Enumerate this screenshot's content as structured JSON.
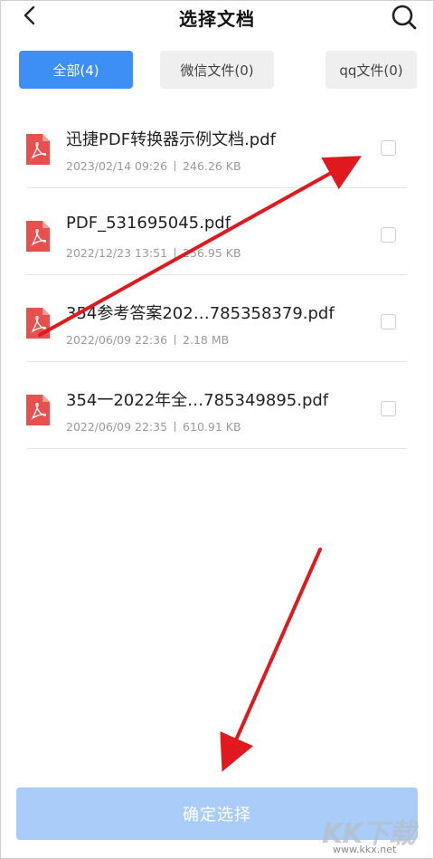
{
  "header": {
    "title": "选择文档",
    "back_icon": "chevron-left-icon",
    "search_icon": "search-icon"
  },
  "tabs": [
    {
      "label": "全部(4)",
      "active": true
    },
    {
      "label": "微信文件(0)",
      "active": false
    },
    {
      "label": "qq文件(0)",
      "active": false
    }
  ],
  "files": [
    {
      "name": "迅捷PDF转换器示例文档.pdf",
      "date": "2023/02/14 09:26",
      "size": "246.26 KB",
      "checked": false
    },
    {
      "name": "PDF_531695045.pdf",
      "date": "2022/12/23 13:51",
      "size": "256.95 KB",
      "checked": false
    },
    {
      "name": "354参考答案202…785358379.pdf",
      "date": "2022/06/09 22:36",
      "size": "2.18 MB",
      "checked": false
    },
    {
      "name": "354一2022年全…785349895.pdf",
      "date": "2022/06/09 22:35",
      "size": "610.91 KB",
      "checked": false
    }
  ],
  "confirm_button": {
    "label": "确定选择"
  },
  "watermark": {
    "logo": "KK下载",
    "url": "www.kkx.net"
  },
  "colors": {
    "accent": "#3d8ef5",
    "tab_inactive": "#efefef",
    "confirm_disabled": "#a9cdf8",
    "pdf_red": "#e8504f",
    "annotation_arrow": "#e0191f"
  }
}
